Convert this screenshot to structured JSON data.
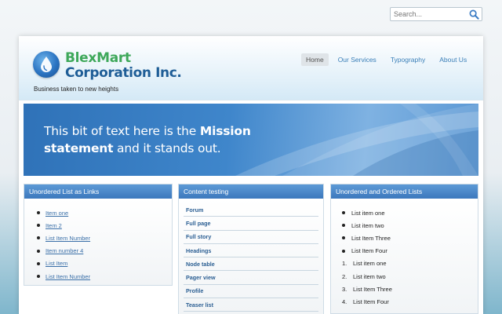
{
  "search": {
    "placeholder": "Search...",
    "icon": "magnifier-icon"
  },
  "header": {
    "brand_line1": "BlexMart",
    "brand_line2": "Corporation Inc.",
    "tagline": "Business taken to new heights",
    "logo_icon": "water-drop-icon"
  },
  "nav": {
    "items": [
      {
        "label": "Home"
      },
      {
        "label": "Our Services"
      },
      {
        "label": "Typography"
      },
      {
        "label": "About Us"
      }
    ]
  },
  "banner": {
    "text_before": "This bit of text here is the ",
    "text_bold": "Mission statement",
    "text_after": " and it stands out."
  },
  "box1": {
    "title": "Unordered List as Links",
    "items": [
      "Item one",
      "Item 2",
      "List Item Number",
      "Item number 4",
      "List Item",
      "List Item Number"
    ]
  },
  "box2": {
    "title": "Content testing",
    "items": [
      "Forum",
      "Full page",
      "Full story",
      "Headings",
      "Node table",
      "Pager view",
      "Profile",
      "Teaser list"
    ]
  },
  "box3": {
    "title": "Unordered and Ordered Lists",
    "unordered": [
      "List item one",
      "List item two",
      "List Item Three",
      "List Item Four"
    ],
    "ordered": [
      "List item one",
      "List item two",
      "List Item Three",
      "List Item Four"
    ],
    "ordered_numbers": [
      "1.",
      "2.",
      "3.",
      "4."
    ]
  },
  "colors": {
    "brand_green": "#3ea85a",
    "brand_blue": "#1f5e97",
    "box_header": "#3c78bd",
    "link": "#3a6fa8"
  }
}
